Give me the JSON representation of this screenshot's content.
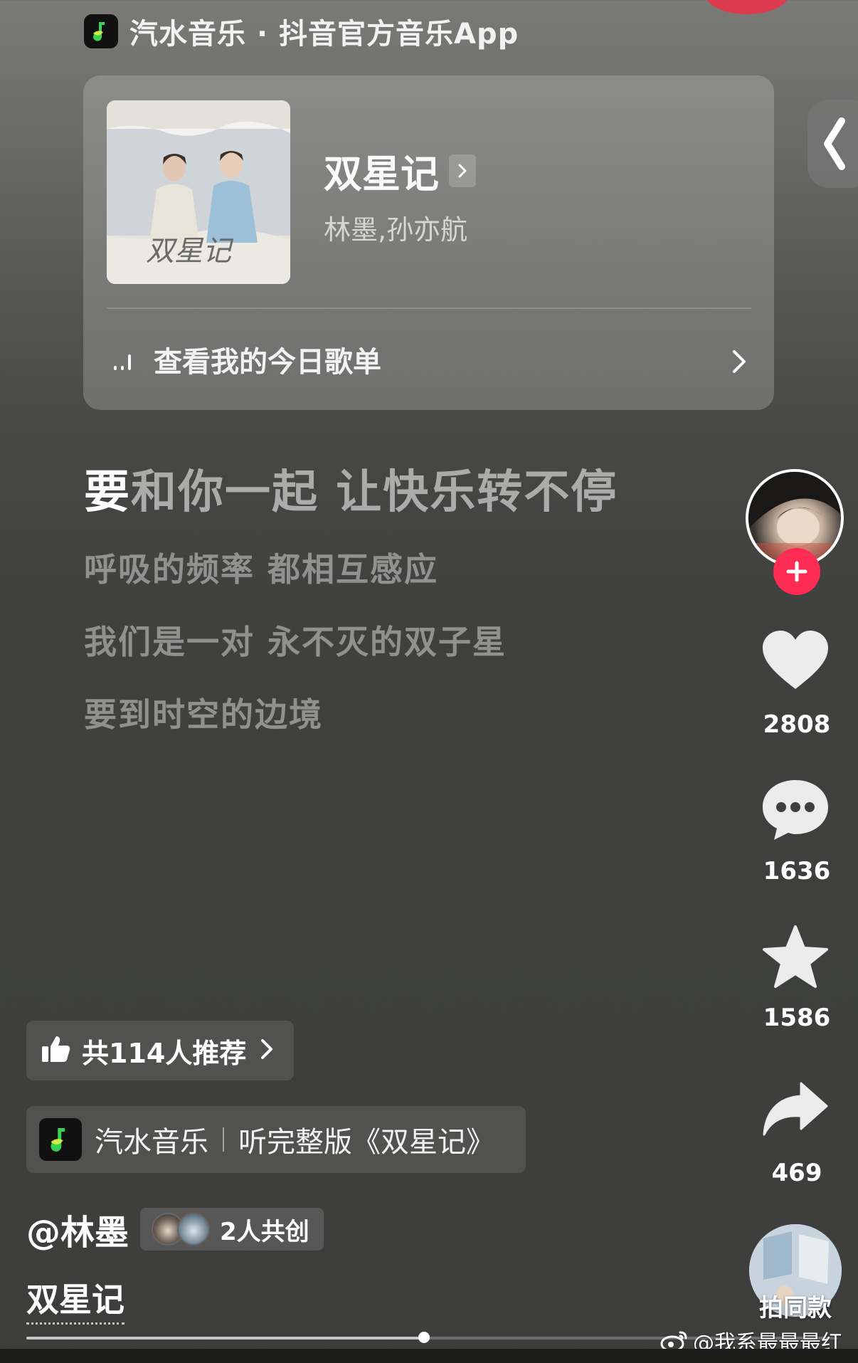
{
  "header": {
    "brand_text": "汽水音乐 · 抖音官方音乐App"
  },
  "song_card": {
    "cover_art_text": "双星记",
    "title": "双星记",
    "artists": "林墨,孙亦航",
    "playlist_label": "查看我的今日歌单"
  },
  "lyrics": {
    "current_highlight": "要",
    "current_rest": "和你一起 让快乐转不停",
    "lines": [
      "呼吸的频率 都相互感应",
      "我们是一对 永不灭的双子星",
      "要到时空的边境"
    ]
  },
  "actions": {
    "likes": "2808",
    "comments": "1636",
    "favorites": "1586",
    "shares": "469",
    "same_style_label": "拍同款"
  },
  "recommend": {
    "label": "共114人推荐"
  },
  "music_link": {
    "app_name": "汽水音乐",
    "cta": "听完整版《双星记》"
  },
  "author": {
    "handle": "@林墨",
    "cocreate_label": "2人共创"
  },
  "caption": "双星记",
  "playback": {
    "progress": 0.49
  },
  "watermark": {
    "text": "@我系最最最红"
  },
  "colors": {
    "follow": "#fe2c55",
    "app_logo_green": "#39d353",
    "app_logo_yellow": "#e6f542"
  },
  "icons": [
    "app-logo-icon",
    "chevron-right-icon",
    "equalizer-icon",
    "chevron-left-icon",
    "plus-icon",
    "heart-icon",
    "comment-icon",
    "star-icon",
    "share-icon",
    "thumbs-up-icon",
    "weibo-icon"
  ]
}
